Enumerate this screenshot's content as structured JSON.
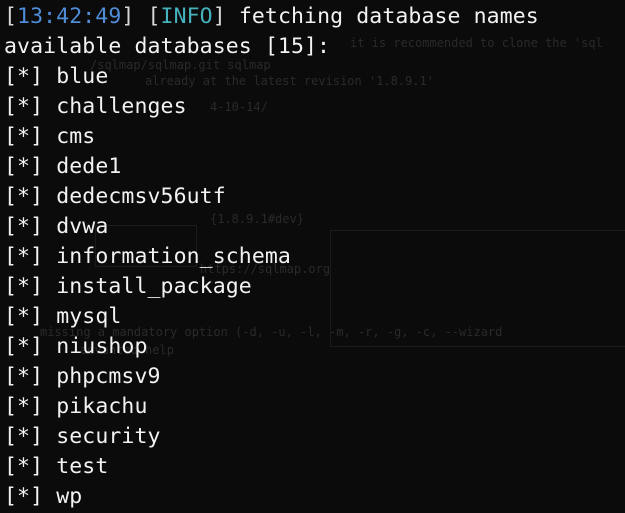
{
  "header": {
    "time_open": "[",
    "time": "13:42:49",
    "time_close": "]",
    "level_open": "[",
    "level": "INFO",
    "level_close": "]",
    "message": "fetching database names"
  },
  "summary_line": "available databases [15]:",
  "bullet": "[*]",
  "databases": [
    "blue",
    "challenges",
    "cms",
    "dede1",
    "dedecmsv56utf",
    "dvwa",
    "information_schema",
    "install_package",
    "mysql",
    "niushop",
    "phpcmsv9",
    "pikachu",
    "security",
    "test",
    "wp"
  ],
  "colors": {
    "background": "#0b0b0b",
    "text": "#f2f2f2",
    "timestamp": "#4f8dd8",
    "info": "#45b3bd"
  }
}
